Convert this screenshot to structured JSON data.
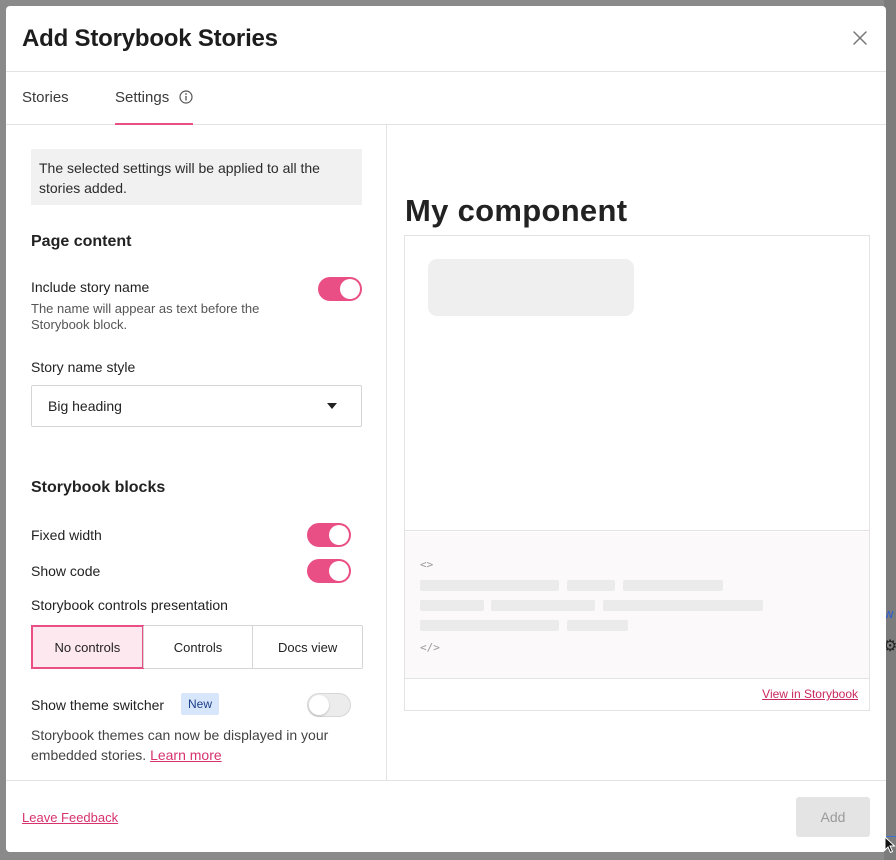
{
  "background": {
    "link_fragment": "w",
    "gear_glyph": "⚙"
  },
  "modal": {
    "title": "Add Storybook Stories"
  },
  "tabs": [
    {
      "label": "Stories",
      "active": false
    },
    {
      "label": "Settings",
      "active": true
    }
  ],
  "settings": {
    "notice": "The selected settings will be applied to all the stories added.",
    "page_content": {
      "heading": "Page content",
      "include_story_name": {
        "label": "Include story name",
        "hint": "The name will appear as text before the Storybook block.",
        "enabled": true
      },
      "story_name_style": {
        "label": "Story name style",
        "value": "Big heading"
      }
    },
    "storybook_blocks": {
      "heading": "Storybook blocks",
      "fixed_width": {
        "label": "Fixed width",
        "enabled": true
      },
      "show_code": {
        "label": "Show code",
        "enabled": true
      },
      "controls_presentation": {
        "label": "Storybook controls presentation",
        "options": [
          "No controls",
          "Controls",
          "Docs view"
        ],
        "selected": "No controls"
      },
      "theme_switcher": {
        "label": "Show theme switcher",
        "badge": "New",
        "enabled": false,
        "description": "Storybook themes can now be displayed in your embedded stories.",
        "learn_more": "Learn more"
      }
    }
  },
  "preview": {
    "title": "My component",
    "code_open_tag": "<>",
    "code_close_tag": "</>",
    "view_link": "View in Storybook"
  },
  "footer": {
    "feedback_link": "Leave Feedback",
    "add_button": "Add"
  },
  "colors": {
    "accent": "#e94e84",
    "link": "#d6336c",
    "badge_bg": "#d8e6fb"
  }
}
